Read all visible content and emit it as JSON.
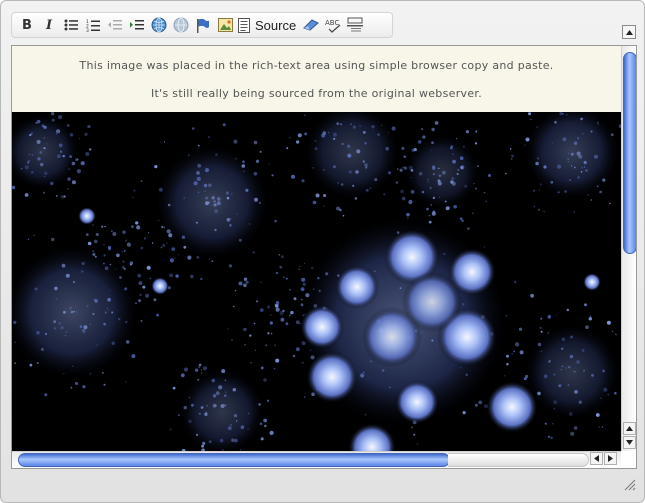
{
  "toolbar": {
    "bold_label": "B",
    "italic_label": "I",
    "source_label": "Source",
    "icons": [
      "bold-icon",
      "italic-icon",
      "bulleted-list-icon",
      "numbered-list-icon",
      "outdent-icon",
      "indent-icon",
      "link-icon",
      "unlink-icon",
      "anchor-flag-icon",
      "image-icon",
      "source-doc-icon",
      "eraser-icon",
      "spellcheck-icon",
      "horizontal-rule-icon"
    ]
  },
  "toggle_icon": "collapse-toolbar-icon",
  "content": {
    "line1": "This image was placed in the rich-text area using simple browser copy and paste.",
    "line2": "It's still really being sourced from the original webserver."
  },
  "colors": {
    "caption_bg": "#f8f6e8",
    "scroll_thumb": "#5a86e6",
    "fractal_glow": "#c9d8ff"
  }
}
